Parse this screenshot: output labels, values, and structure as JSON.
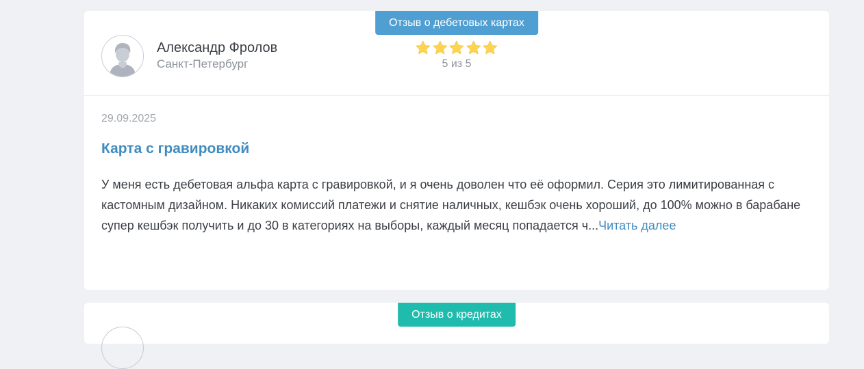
{
  "reviews": [
    {
      "category": "Отзыв о дебетовых картах",
      "category_color": "#4f9fd3",
      "author": "Александр Фролов",
      "city": "Санкт-Петербург",
      "rating": 5,
      "rating_max": 5,
      "rating_text": "5 из 5",
      "date": "29.09.2025",
      "title": "Карта с гравировкой",
      "text": "У меня есть дебетовая альфа карта с гравировкой, и я очень доволен что её оформил. Серия это лимитированная с кастомным дизайном. Никаких комиссий платежи и снятие наличных, кешбэк очень хороший, до 100% можно в барабане супер кешбэк получить и до 30 в категориях на выборы, каждый месяц попадается ч...",
      "read_more": "Читать далее",
      "avatar_icon": "user-avatar-icon",
      "star_icon": "star-icon"
    },
    {
      "category": "Отзыв о кредитах",
      "category_color": "#1fbbad"
    }
  ],
  "colors": {
    "background": "#eff1f4",
    "card": "#ffffff",
    "link": "#3f8cc0",
    "star": "#ffd54f",
    "muted_text": "#8d939b"
  }
}
